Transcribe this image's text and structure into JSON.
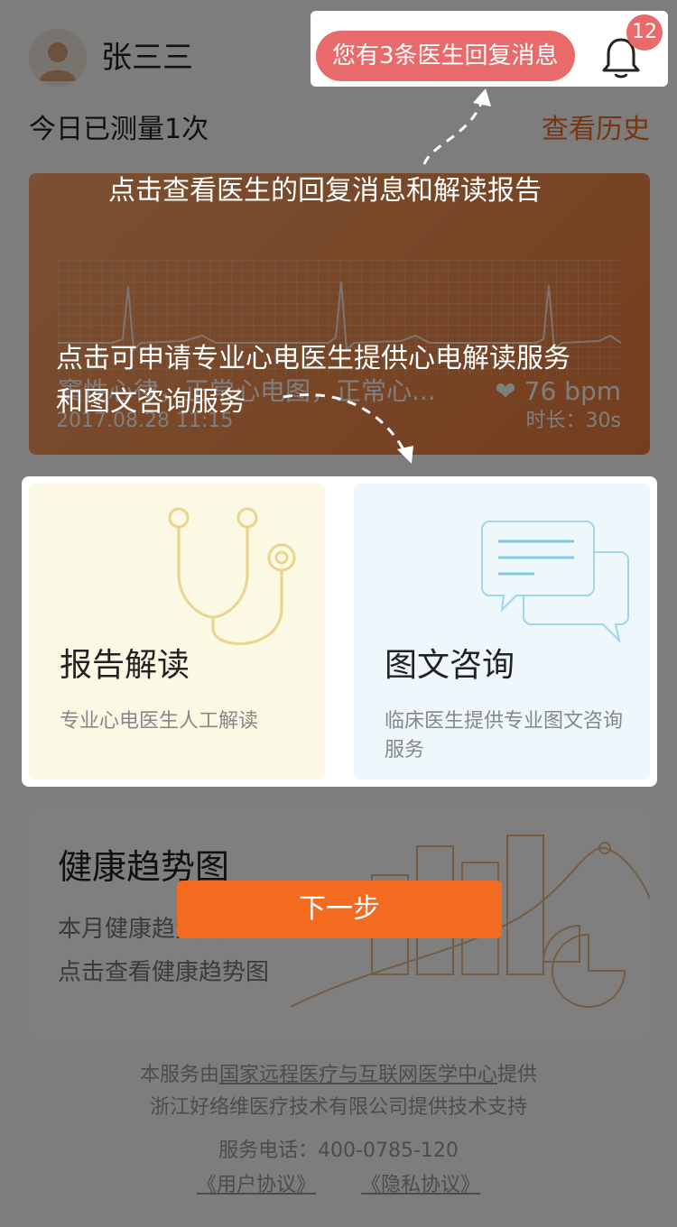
{
  "header": {
    "username": "张三三",
    "notification_text": "您有3条医生回复消息",
    "badge_count": "12"
  },
  "measure": {
    "today_text": "今日已测量1次",
    "history_link": "查看历史"
  },
  "ecg": {
    "diagnosis": "窦性心律，正常心电图，正常心...",
    "heart_rate": "❤ 76 bpm",
    "datetime": "2017.08.28 11:15",
    "duration": "时长：30s"
  },
  "services": {
    "report": {
      "title": "报告解读",
      "desc": "专业心电医生人工解读"
    },
    "consult": {
      "title": "图文咨询",
      "desc": "临床医生提供专业图文咨询服务"
    }
  },
  "trend": {
    "title": "健康趋势图",
    "line1": "本月健康趋势图已生成",
    "line2": "点击查看健康趋势图"
  },
  "footer": {
    "provider_prefix": "本服务由",
    "provider_org": "国家远程医疗与互联网医学中心",
    "provider_suffix": "提供",
    "tech_support": "浙江好络维医疗技术有限公司提供技术支持",
    "phone": "服务电话：400-0785-120",
    "user_agreement": "《用户协议》",
    "privacy_agreement": "《隐私协议》"
  },
  "guide": {
    "tip_top": "点击查看医生的回复消息和解读报告",
    "tip_mid_line1": "点击可申请专业心电医生提供心电解读服务",
    "tip_mid_line2": "和图文咨询服务",
    "next_button": "下一步"
  },
  "colors": {
    "accent": "#f26b21",
    "notification": "#e96a6a",
    "overlay": "rgba(0,0,0,0.5)"
  }
}
